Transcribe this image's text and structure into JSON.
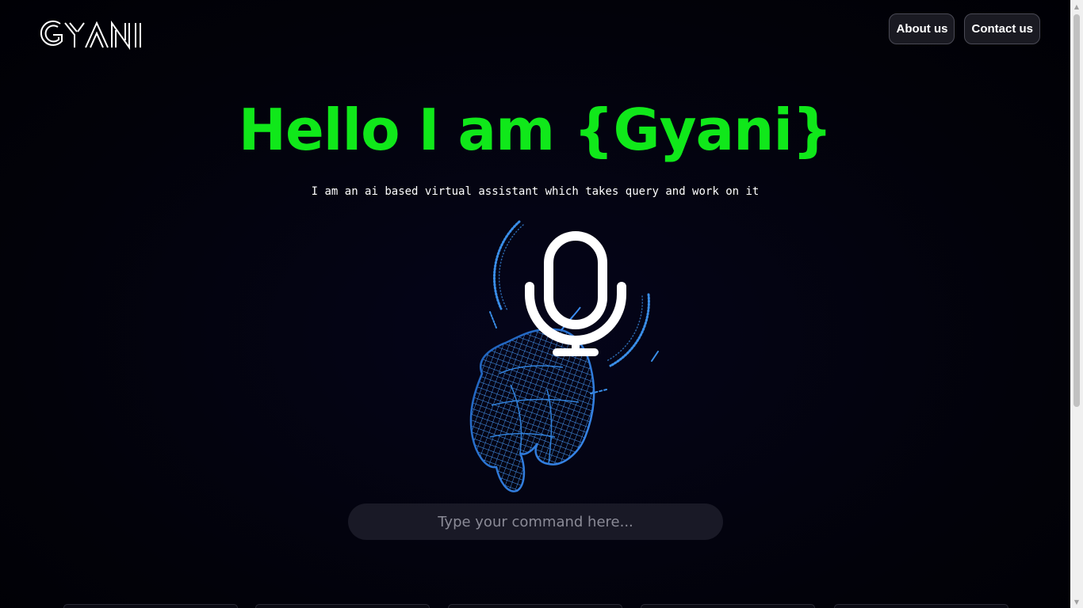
{
  "header": {
    "logo_text": "GYANI",
    "nav": [
      {
        "label": "About us"
      },
      {
        "label": "Contact us"
      }
    ]
  },
  "hero": {
    "title": "Hello I am {Gyani}",
    "subtitle": "I am an ai based virtual assistant which takes query and work on it"
  },
  "art": {
    "icons": [
      "microphone-icon",
      "wireframe-hand-icon"
    ],
    "colors": {
      "mic": "#ffffff",
      "hand": "#2f7fd8",
      "ring": "#3a8ee8"
    }
  },
  "command": {
    "placeholder": "Type your command here...",
    "value": ""
  },
  "colors": {
    "accent": "#10e81a",
    "background": "#03030c",
    "button_bg": "#1a1a22"
  }
}
